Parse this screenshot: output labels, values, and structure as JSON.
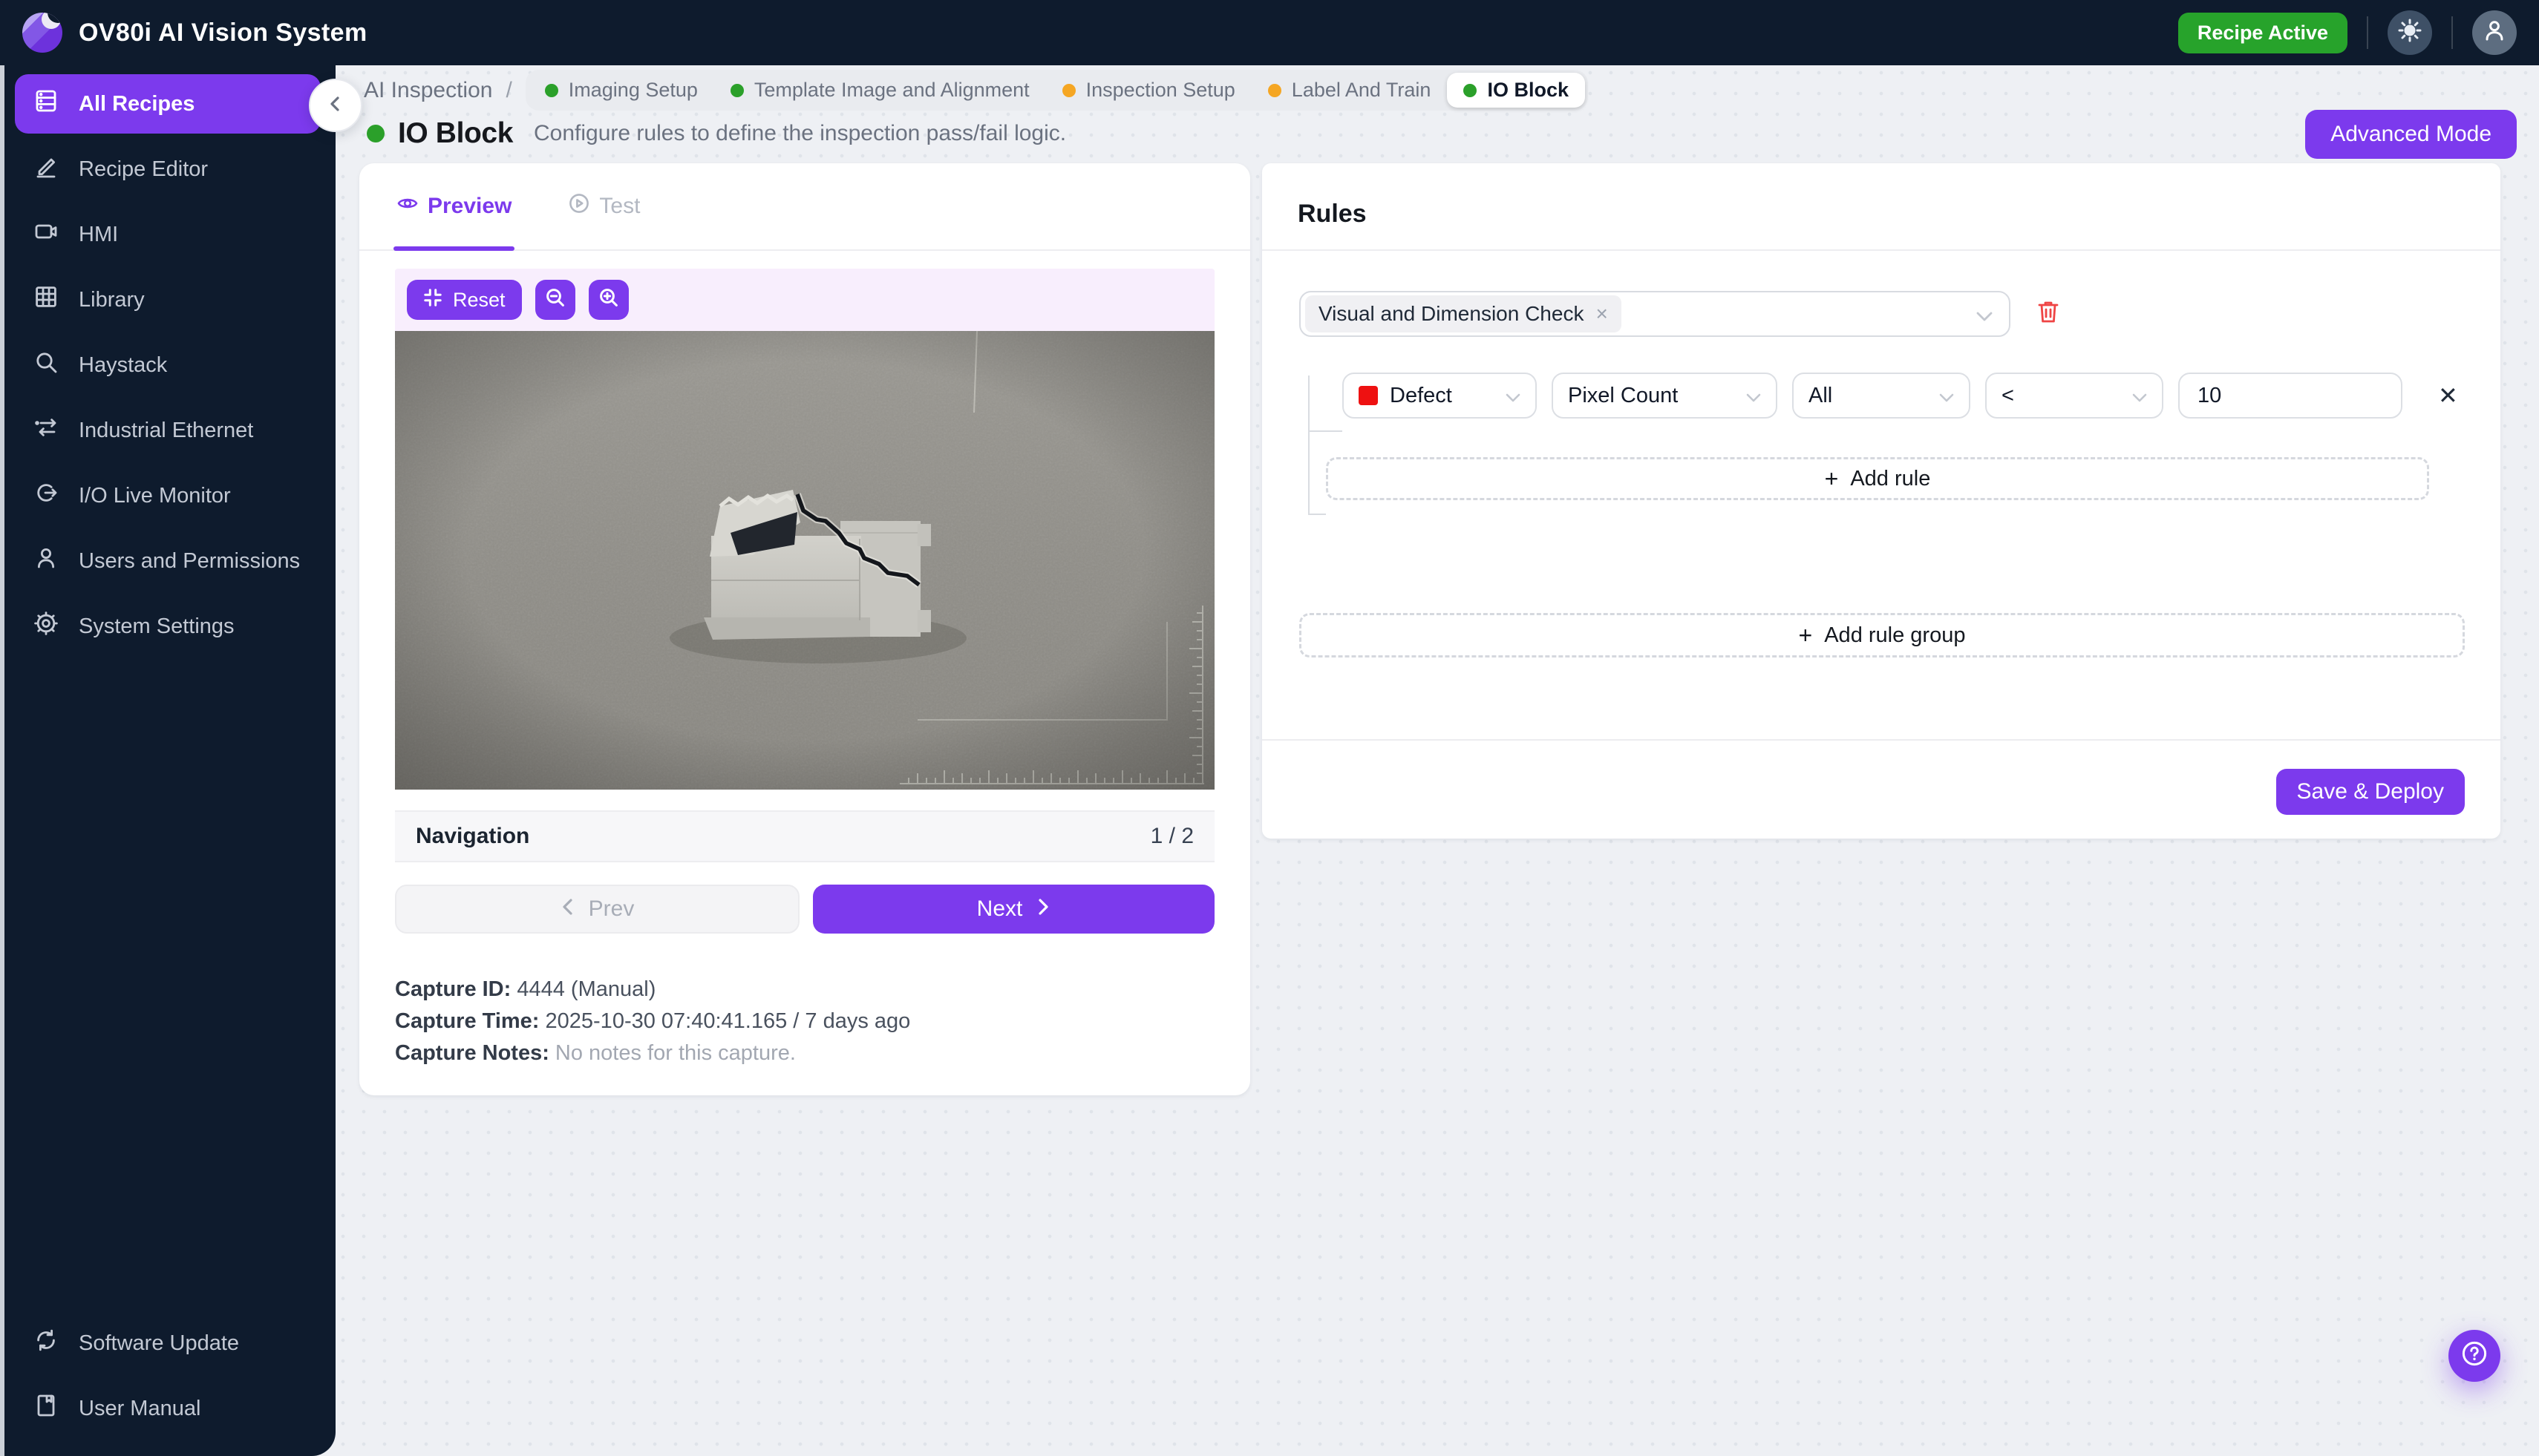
{
  "colors": {
    "navy": "#0e1b2d",
    "accent_purple": "#7c3aed",
    "status_green": "#27a32b",
    "step_green": "#2ba02a",
    "step_orange": "#f5a623",
    "danger_red": "#ef4444",
    "defect_red": "#ee1111",
    "toolbar_lavender": "#f8eefd"
  },
  "topbar": {
    "app_title": "OV80i AI Vision System",
    "status_badge": "Recipe Active"
  },
  "sidebar": {
    "items": [
      {
        "label": "All Recipes"
      },
      {
        "label": "Recipe Editor"
      },
      {
        "label": "HMI"
      },
      {
        "label": "Library"
      },
      {
        "label": "Haystack"
      },
      {
        "label": "Industrial Ethernet"
      },
      {
        "label": "I/O Live Monitor"
      },
      {
        "label": "Users and Permissions"
      },
      {
        "label": "System Settings"
      }
    ],
    "footer_items": [
      {
        "label": "Software Update"
      },
      {
        "label": "User Manual"
      }
    ]
  },
  "breadcrumb": {
    "root": "AI Inspection",
    "separator": "/",
    "steps": [
      {
        "label": "Imaging Setup",
        "color": "#2ba02a"
      },
      {
        "label": "Template Image and Alignment",
        "color": "#2ba02a"
      },
      {
        "label": "Inspection Setup",
        "color": "#f5a623"
      },
      {
        "label": "Label And Train",
        "color": "#f5a623"
      },
      {
        "label": "IO Block",
        "color": "#2ba02a"
      }
    ]
  },
  "page": {
    "status_dot_color": "#2ba02a",
    "title": "IO Block",
    "subtitle": "Configure rules to define the inspection pass/fail logic.",
    "advanced_mode": "Advanced Mode"
  },
  "preview_panel": {
    "tabs": {
      "preview": "Preview",
      "test": "Test"
    },
    "toolbar": {
      "reset": "Reset"
    },
    "navigation": {
      "title": "Navigation",
      "counter": "1 / 2",
      "prev": "Prev",
      "next": "Next"
    },
    "capture": {
      "id_label": "Capture ID:",
      "id_value": "4444 (Manual)",
      "time_label": "Capture Time:",
      "time_value": "2025-10-30 07:40:41.165 / 7 days ago",
      "notes_label": "Capture Notes:",
      "notes_value": "No notes for this capture."
    }
  },
  "rules_panel": {
    "title": "Rules",
    "group_selected_tag": "Visual and Dimension Check",
    "rule": {
      "target": "Defect",
      "target_color": "#ee1111",
      "metric": "Pixel Count",
      "scope": "All",
      "operator": "<",
      "value": "10"
    },
    "add_rule": "Add rule",
    "add_rule_group": "Add rule group",
    "save": "Save & Deploy"
  },
  "glyphs": {
    "plus": "+",
    "tag_remove": "×",
    "rule_remove": "✕"
  }
}
